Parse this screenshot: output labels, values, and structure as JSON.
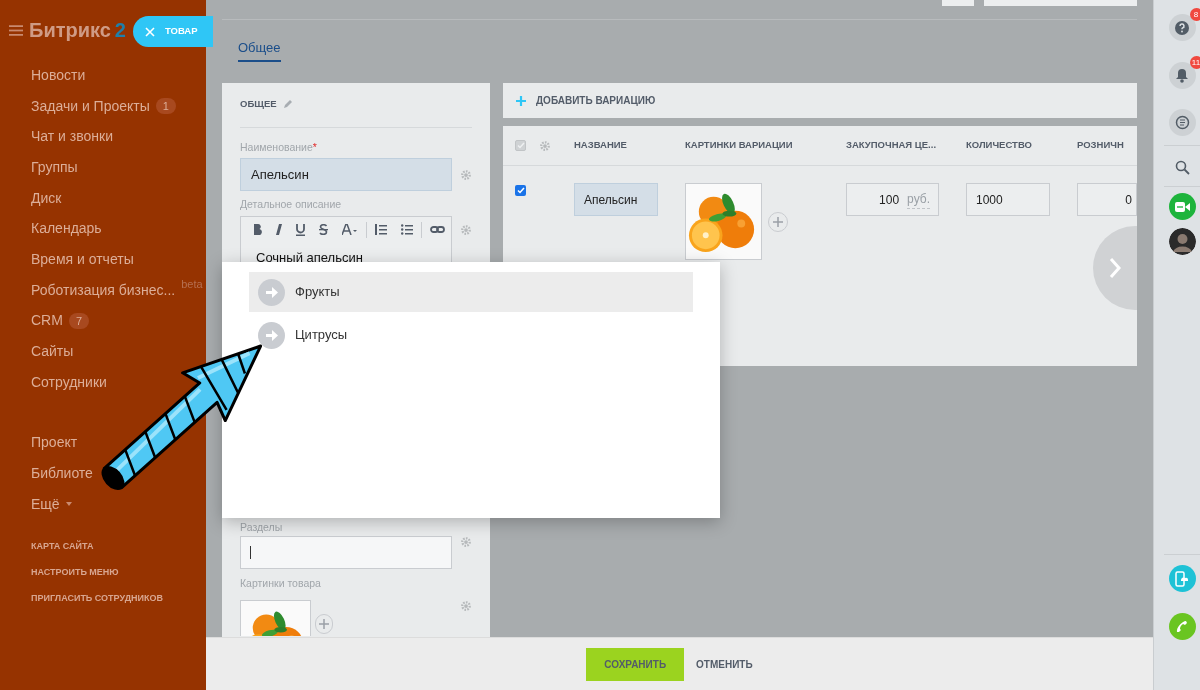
{
  "sidebar": {
    "logo": "Битрикс",
    "logo_accent": "2",
    "menu": [
      {
        "label": "Новости"
      },
      {
        "label": "Задачи и Проекты",
        "counter": "1"
      },
      {
        "label": "Чат и звонки"
      },
      {
        "label": "Группы"
      },
      {
        "label": "Диск"
      },
      {
        "label": "Календарь"
      },
      {
        "label": "Время и отчеты"
      },
      {
        "label": "Роботизация бизнес...",
        "tag": "beta"
      },
      {
        "label": "CRM",
        "counter": "7"
      },
      {
        "label": "Сайты"
      },
      {
        "label": "Сотрудники"
      }
    ],
    "menu_extra": [
      {
        "label": "Проект"
      },
      {
        "label": "Библиоте"
      },
      {
        "label": "Ещё",
        "dropdown": true
      }
    ],
    "footer_links": [
      "КАРТА САЙТА",
      "НАСТРОИТЬ МЕНЮ",
      "ПРИГЛАСИТЬ СОТРУДНИКОВ"
    ]
  },
  "slider": {
    "close_label": "ТОВАР",
    "tabs": [
      {
        "label": "Общее",
        "selected": true
      }
    ],
    "general": {
      "title": "ОБЩЕЕ",
      "name_label": "Наименование",
      "required_mark": "*",
      "name_value": "Апельсин",
      "description_label": "Детальное описание",
      "description_text": "Сочный апельсин",
      "sections_label": "Разделы",
      "pictures_label": "Картинки товара"
    },
    "variations": {
      "select_all": {
        "checked": true,
        "disabled": true
      },
      "add_label": "ДОБАВИТЬ ВАРИАЦИЮ",
      "columns": [
        "НАЗВАНИЕ",
        "КАРТИНКИ ВАРИАЦИИ",
        "ЗАКУПОЧНАЯ ЦЕ...",
        "КОЛИЧЕСТВО",
        "РОЗНИЧН"
      ],
      "rows": [
        {
          "checked": true,
          "name": "Апельсин",
          "purchase_price": "100",
          "currency": "руб.",
          "quantity": "1000",
          "column_5": "0"
        }
      ]
    }
  },
  "dropdown": {
    "items": [
      {
        "label": "Фрукты",
        "selected": true
      },
      {
        "label": "Цитрусы",
        "selected": false
      }
    ]
  },
  "buttons": {
    "save": "СОХРАНИТЬ",
    "cancel": "ОТМЕНИТЬ"
  },
  "right_rail": {
    "help_count": "8",
    "notifications_count": "11"
  }
}
